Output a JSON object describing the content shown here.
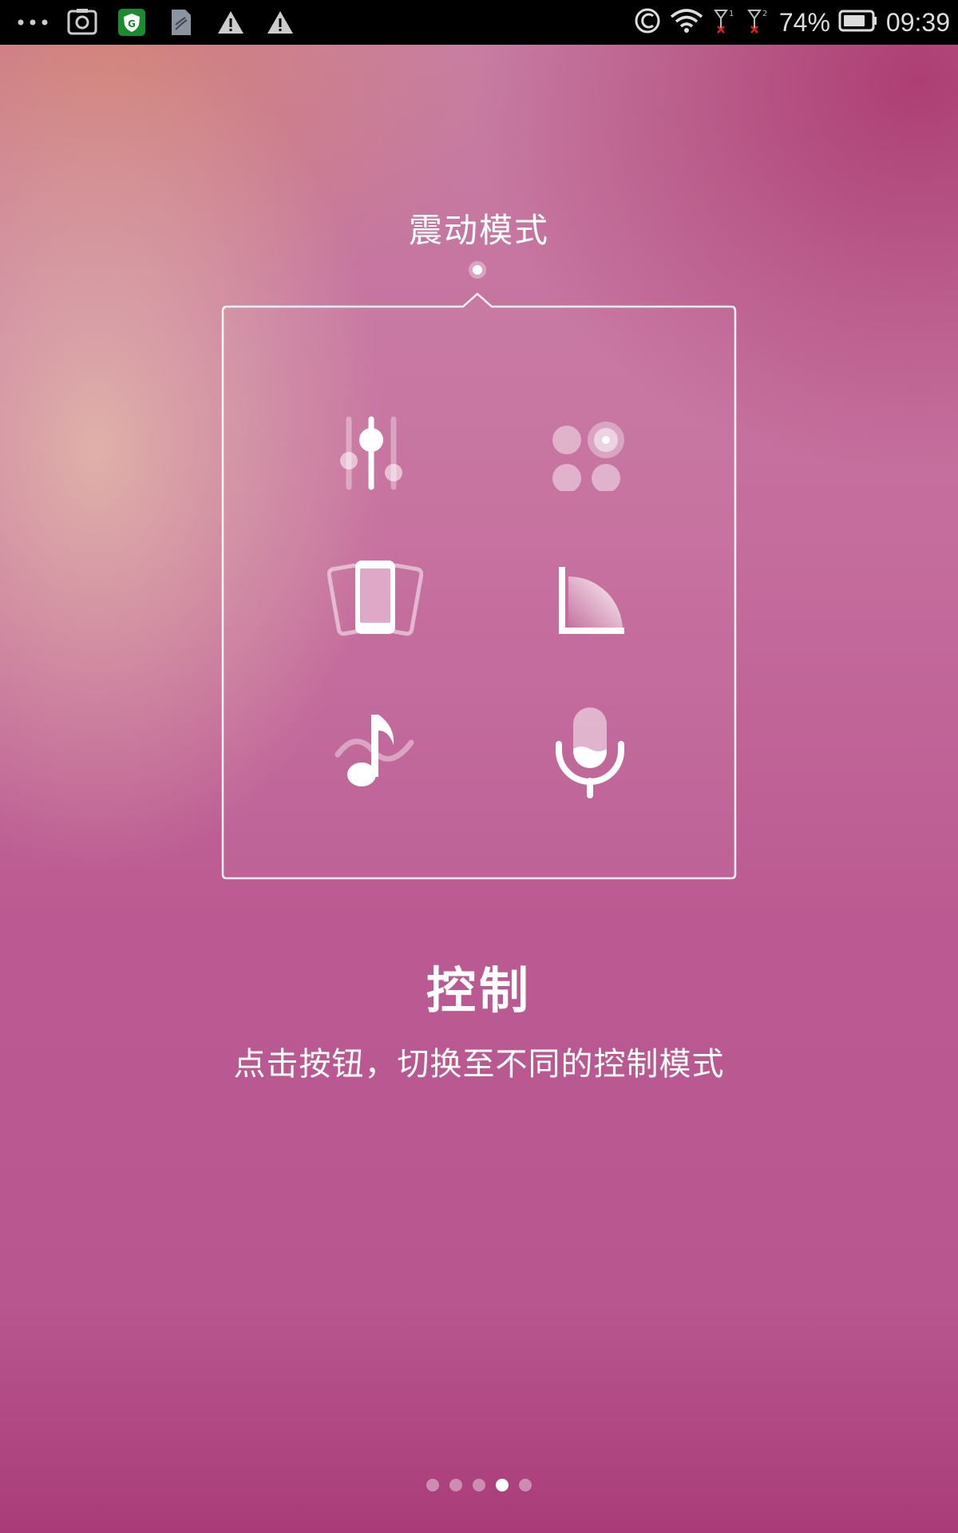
{
  "status_bar": {
    "battery": "74%",
    "time": "09:39",
    "left_icons": [
      "more-icon",
      "screenshot-icon",
      "shield-app-icon",
      "sim-card-icon",
      "warning-icon",
      "warning-icon"
    ],
    "right_icons": [
      "browser-c-icon",
      "wifi-icon",
      "signal-1-icon",
      "signal-2-icon",
      "battery-icon"
    ]
  },
  "mode": {
    "label": "震动模式"
  },
  "panel": {
    "icons": [
      "equalizer-icon",
      "dots-grid-icon",
      "phone-shake-icon",
      "angle-sweep-icon",
      "music-note-icon",
      "microphone-icon"
    ]
  },
  "section": {
    "title": "控制",
    "description": "点击按钮，切换至不同的控制模式"
  },
  "pager": {
    "count": 5,
    "active_index": 3
  },
  "colors": {
    "status_bar_bg": "#000000",
    "accent_pink": "#bb5a92"
  }
}
